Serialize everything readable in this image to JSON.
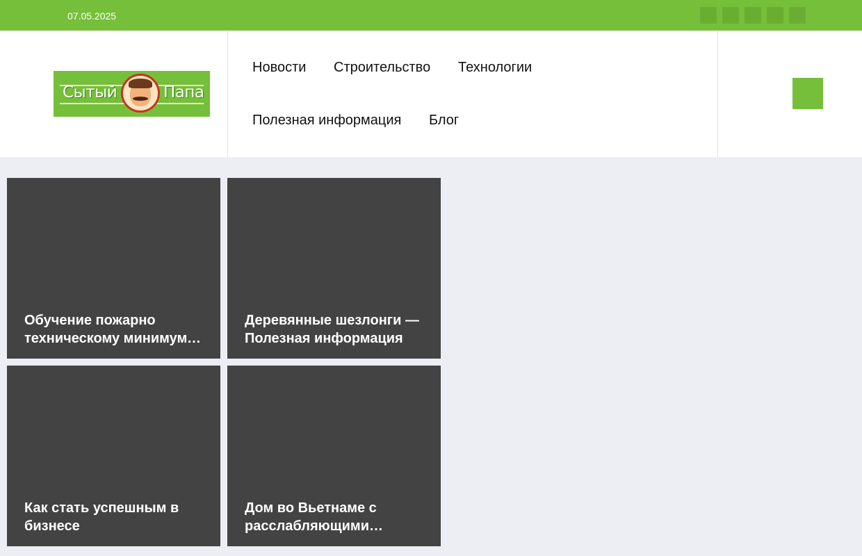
{
  "topbar": {
    "date": "07.05.2025",
    "social_icons": [
      "social-icon-1",
      "social-icon-2",
      "social-icon-3",
      "social-icon-4",
      "social-icon-5"
    ],
    "background_color": "#76bf3a"
  },
  "logo": {
    "word_left": "Сытый",
    "word_right": "Папа",
    "background_color": "#76bf3a"
  },
  "nav": {
    "items": [
      {
        "label": "Новости"
      },
      {
        "label": "Строительство"
      },
      {
        "label": "Технологии"
      },
      {
        "label": "Полезная информация"
      },
      {
        "label": "Блог"
      }
    ]
  },
  "search": {
    "icon": "search-icon",
    "color": "#76bf3a"
  },
  "articles": [
    {
      "title": "Обучение пожарно техническому минимуму в Москве"
    },
    {
      "title": "Деревянные шезлонги — Полезная информация"
    },
    {
      "title": "Как стать успешным в бизнесе"
    },
    {
      "title": "Дом во Вьетнаме с расслабляющими видами"
    }
  ]
}
